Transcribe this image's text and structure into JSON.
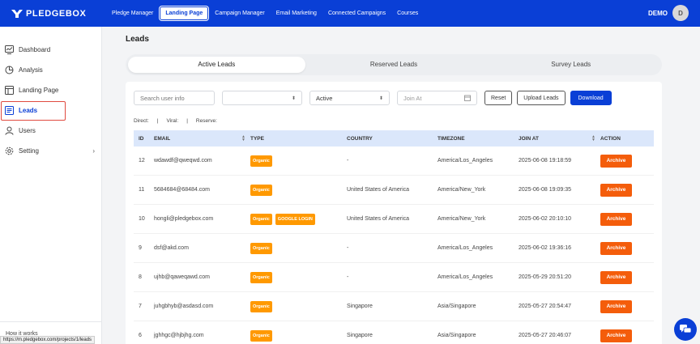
{
  "brand": {
    "name": "PLEDGEBOX",
    "accent": "#0a3fd6"
  },
  "nav": [
    {
      "label": "Pledge Manager",
      "active": false
    },
    {
      "label": "Landing Page",
      "active": true
    },
    {
      "label": "Campaign Manager",
      "active": false
    },
    {
      "label": "Email Marketing",
      "active": false
    },
    {
      "label": "Connected Campaigns",
      "active": false
    },
    {
      "label": "Courses",
      "active": false
    }
  ],
  "user": {
    "name": "DEMO",
    "initial": "D"
  },
  "sidebar": {
    "items": [
      {
        "label": "Dashboard",
        "icon": "dashboard-icon"
      },
      {
        "label": "Analysis",
        "icon": "analysis-icon"
      },
      {
        "label": "Landing Page",
        "icon": "landing-page-icon"
      },
      {
        "label": "Leads",
        "icon": "leads-icon",
        "active": true
      },
      {
        "label": "Users",
        "icon": "users-icon"
      },
      {
        "label": "Setting",
        "icon": "gear-icon",
        "has_arrow": true
      }
    ],
    "how_it_works": "How it works",
    "status_url": "https://m.pledgebox.com/projects/1/leads"
  },
  "page": {
    "title": "Leads"
  },
  "tabs": [
    {
      "label": "Active Leads",
      "active": true
    },
    {
      "label": "Reserved Leads",
      "active": false
    },
    {
      "label": "Survey Leads",
      "active": false
    }
  ],
  "filters": {
    "search_placeholder": "Search user info",
    "select1_value": "",
    "status_value": "Active",
    "join_at_placeholder": "Join At",
    "reset_label": "Reset",
    "upload_label": "Upload Leads",
    "download_label": "Download"
  },
  "stats": {
    "direct": "Direct:",
    "viral": "Viral:",
    "reserve": "Reserve:",
    "sep": "|"
  },
  "table": {
    "headers": {
      "id": "ID",
      "email": "EMAIL",
      "type": "TYPE",
      "country": "COUNTRY",
      "timezone": "TIMEZONE",
      "join_at": "JOIN AT",
      "action": "ACTION"
    },
    "action_label": "Archive",
    "rows": [
      {
        "id": "12",
        "email": "wdawdf@qweqwd.com",
        "types": [
          "Organic"
        ],
        "country": "-",
        "timezone": "America/Los_Angeles",
        "join_at": "2025-06-08 19:18:59"
      },
      {
        "id": "11",
        "email": "5684684@68484.com",
        "types": [
          "Organic"
        ],
        "country": "United States of America",
        "timezone": "America/New_York",
        "join_at": "2025-06-08 19:09:35"
      },
      {
        "id": "10",
        "email": "hongli@pledgebox.com",
        "types": [
          "Organic",
          "GOOGLE LOGIN"
        ],
        "country": "United States of America",
        "timezone": "America/New_York",
        "join_at": "2025-06-02 20:10:10"
      },
      {
        "id": "9",
        "email": "dsf@akd.com",
        "types": [
          "Organic"
        ],
        "country": "-",
        "timezone": "America/Los_Angeles",
        "join_at": "2025-06-02 19:36:16"
      },
      {
        "id": "8",
        "email": "ujhb@qaweqawd.com",
        "types": [
          "Organic"
        ],
        "country": "-",
        "timezone": "America/Los_Angeles",
        "join_at": "2025-05-29 20:51:20"
      },
      {
        "id": "7",
        "email": "juhgbhyb@asdasd.com",
        "types": [
          "Organic"
        ],
        "country": "Singapore",
        "timezone": "Asia/Singapore",
        "join_at": "2025-05-27 20:54:47"
      },
      {
        "id": "6",
        "email": "jghhgc@hjbjhg.com",
        "types": [
          "Organic"
        ],
        "country": "Singapore",
        "timezone": "Asia/Singapore",
        "join_at": "2025-05-27 20:46:07"
      }
    ]
  },
  "chat": {
    "icon": "chat-icon"
  }
}
